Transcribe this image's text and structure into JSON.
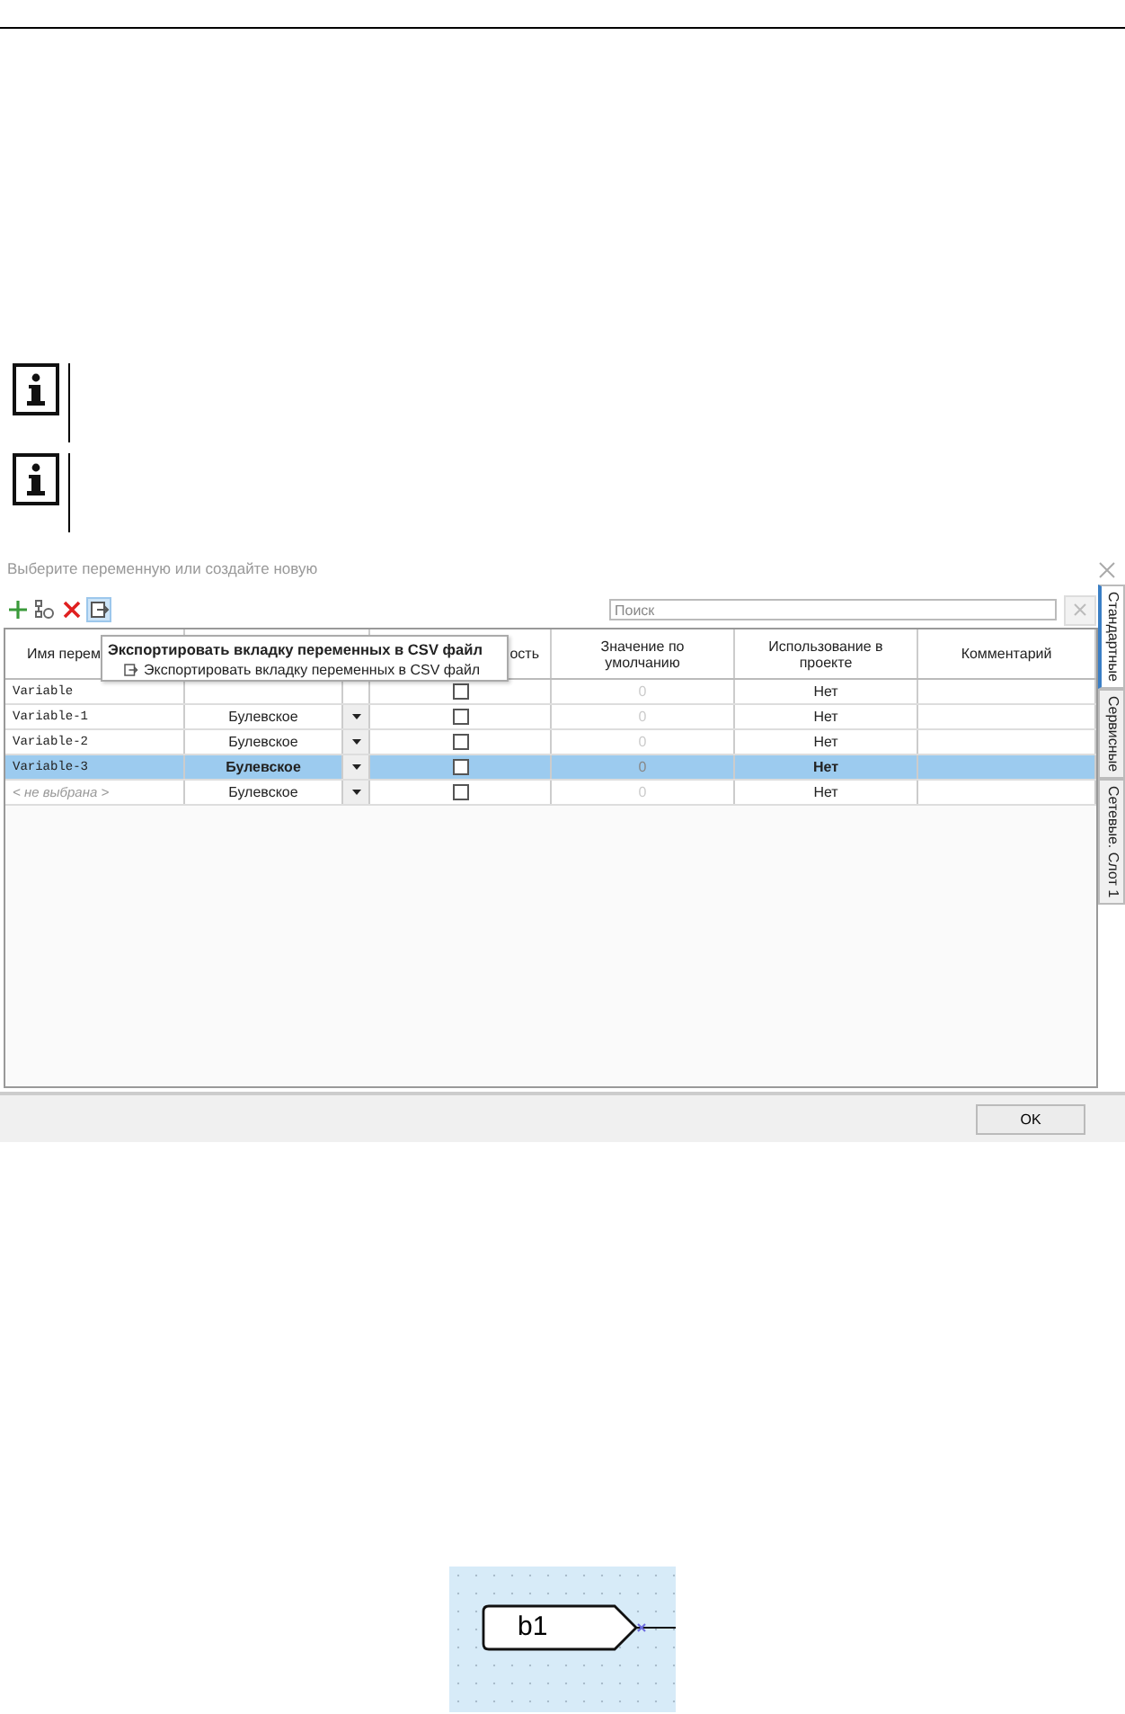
{
  "dialog": {
    "title": "Выберите переменную или создайте новую",
    "toolbar": [
      {
        "kind": "add",
        "hovered": false
      },
      {
        "kind": "link",
        "hovered": false
      },
      {
        "kind": "delete",
        "hovered": false
      },
      {
        "kind": "export",
        "hovered": true
      }
    ],
    "search": {
      "placeholder": "Поиск"
    },
    "tooltip": {
      "title": "Экспортировать вкладку переменных в CSV файл",
      "item": "Экспортировать вкладку переменных в CSV файл"
    },
    "table": {
      "columns": [
        "Имя перем",
        "",
        "ость",
        "Значение по умолчанию",
        "Использование в проекте",
        "Комментарий"
      ],
      "rows": [
        {
          "kind": "variable",
          "name": "Variable",
          "checked": false,
          "default": "0",
          "usage": "Нет",
          "selected": false
        },
        {
          "kind": "variable",
          "name": "Variable-1",
          "type": "Булевское",
          "checked": false,
          "default": "0",
          "usage": "Нет",
          "selected": false
        },
        {
          "kind": "variable",
          "name": "Variable-2",
          "type": "Булевское",
          "checked": false,
          "default": "0",
          "usage": "Нет",
          "selected": false
        },
        {
          "kind": "variable",
          "name": "Variable-3",
          "type": "Булевское",
          "checked": false,
          "default": "0",
          "usage": "Нет",
          "selected": true
        },
        {
          "kind": "placeholder",
          "name": "< не выбрана >",
          "type": "Булевское",
          "checked": false,
          "default": "0",
          "usage": "Нет",
          "selected": false
        }
      ]
    },
    "side_tabs": [
      {
        "label": "Стандартные",
        "selected": true
      },
      {
        "label": "Сервисные",
        "selected": false
      },
      {
        "label": "Сетевые. Слот 1",
        "selected": false
      }
    ],
    "buttons": [
      "OK"
    ]
  },
  "diagram": {
    "block": "b1"
  }
}
